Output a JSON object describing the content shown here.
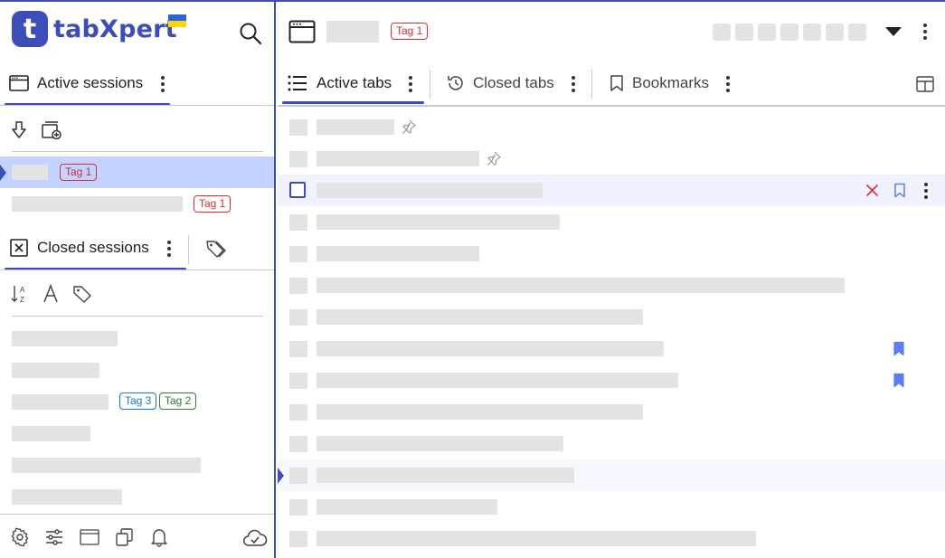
{
  "app": {
    "name": "tabXpert",
    "logo_letter": "t",
    "brand_color": "#3d4db7"
  },
  "sidebar": {
    "active_sessions": {
      "label": "Active sessions",
      "icon": "browser-window-icon",
      "toolbar": [
        "download-icon",
        "new-window-icon"
      ],
      "items": [
        {
          "tag": "Tag 1",
          "tag_color": "#d32f2f",
          "selected": true
        },
        {
          "tag": "Tag 1",
          "tag_color": "#d32f2f",
          "selected": false
        }
      ]
    },
    "closed_sessions": {
      "label": "Closed sessions",
      "icon": "close-box-icon",
      "toolbar": [
        "sort-az-icon",
        "font-icon",
        "tag-icon"
      ],
      "items": [
        {
          "tags": []
        },
        {
          "tags": []
        },
        {
          "tags": [
            {
              "label": "Tag 3",
              "color": "#1976d2"
            },
            {
              "label": "Tag 2",
              "color": "#2e7d32"
            }
          ]
        },
        {
          "tags": []
        },
        {
          "tags": []
        },
        {
          "tags": []
        }
      ]
    },
    "footer_icons": [
      "settings-icon",
      "sliders-icon",
      "window-icon",
      "copy-icon",
      "bell-icon",
      "cloud-check-icon"
    ]
  },
  "main": {
    "header": {
      "tag": "Tag 1",
      "tag_color": "#d32f2f"
    },
    "tabs": [
      {
        "label": "Active tabs",
        "icon": "list-icon",
        "active": true
      },
      {
        "label": "Closed tabs",
        "icon": "history-icon",
        "active": false
      },
      {
        "label": "Bookmarks",
        "icon": "bookmark-icon",
        "active": false
      }
    ],
    "rows": [
      {
        "pinned": true,
        "bookmarked": false
      },
      {
        "pinned": true,
        "bookmarked": false
      },
      {
        "pinned": false,
        "bookmarked": false,
        "hovered": true
      },
      {
        "pinned": false,
        "bookmarked": false
      },
      {
        "pinned": false,
        "bookmarked": false
      },
      {
        "pinned": false,
        "bookmarked": false
      },
      {
        "pinned": false,
        "bookmarked": false
      },
      {
        "pinned": false,
        "bookmarked": true
      },
      {
        "pinned": false,
        "bookmarked": true
      },
      {
        "pinned": false,
        "bookmarked": false
      },
      {
        "pinned": false,
        "bookmarked": false
      },
      {
        "pinned": false,
        "bookmarked": false,
        "current": true
      },
      {
        "pinned": false,
        "bookmarked": false
      },
      {
        "pinned": false,
        "bookmarked": false
      }
    ],
    "accent_bookmark_color": "#5b7ff0",
    "close_color": "#e53935"
  }
}
